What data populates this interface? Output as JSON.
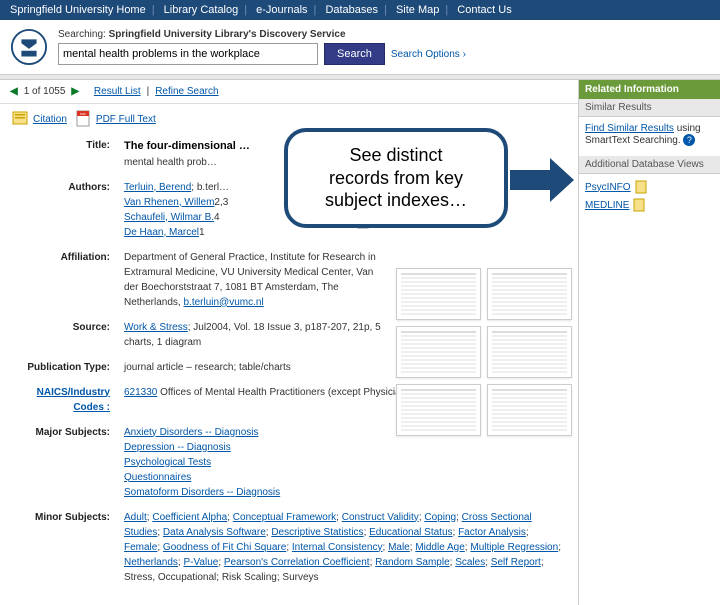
{
  "topnav": {
    "items": [
      "Springfield University Home",
      "Library Catalog",
      "e-Journals",
      "Databases",
      "Site Map",
      "Contact Us"
    ]
  },
  "search": {
    "label_prefix": "Searching:",
    "label_bold": "Springfield University Library's Discovery Service",
    "value": "mental health problems in the workplace",
    "button": "Search",
    "options": "Search Options ›"
  },
  "pager": {
    "position": "1 of 1055",
    "result_list": "Result List",
    "refine": "Refine Search"
  },
  "toolbar": {
    "citation": "Citation",
    "pdf": "PDF Full Text"
  },
  "record": {
    "title_label": "Title:",
    "title": "The four-dimensional …",
    "title_rest": "mental health prob…",
    "authors_label": "Authors:",
    "authors": [
      {
        "link": "Terluin, Berend",
        "rest": "; b.terl…"
      },
      {
        "link": "Van Rhenen, Willem",
        "rest": "2,3"
      },
      {
        "link": "Schaufeli, Wilmar B.",
        "rest": "4"
      },
      {
        "link": "De Haan, Marcel",
        "rest": "1"
      }
    ],
    "affiliation_label": "Affiliation:",
    "affiliation": "Department of General Practice, Institute for Research in Extramural Medicine, VU University Medical Center, Van der Boechorststraat 7, 1081 BT Amsterdam, The Netherlands, ",
    "affiliation_link": "b.terluin@vumc.nl",
    "source_label": "Source:",
    "source_link": "Work & Stress",
    "source_rest": "; Jul2004, Vol. 18 Issue 3, p187-207, 21p, 5 charts, 1 diagram",
    "pubtype_label": "Publication Type:",
    "pubtype": "journal article – research; table/charts",
    "naics_label": "NAICS/Industry Codes :",
    "naics_link": "621330",
    "naics_rest": " Offices of Mental Health Practitioners (except Physicians)",
    "major_label": "Major Subjects:",
    "major": [
      "Anxiety Disorders -- Diagnosis",
      "Depression -- Diagnosis",
      "Psychological Tests",
      "Questionnaires",
      "Somatoform Disorders -- Diagnosis"
    ],
    "minor_label": "Minor Subjects:",
    "minor_links": [
      "Adult",
      "Coefficient Alpha",
      "Conceptual Framework",
      "Construct Validity",
      "Coping",
      "Cross Sectional Studies",
      "Data Analysis Software",
      "Descriptive Statistics",
      "Educational Status",
      "Factor Analysis",
      "Female",
      "Goodness of Fit Chi Square",
      "Internal Consistency",
      "Male",
      "Middle Age",
      "Multiple Regression",
      "Netherlands",
      "P-Value",
      "Pearson's Correlation Coefficient",
      "Random Sample",
      "Scales",
      "Self Report"
    ],
    "minor_plain": "; Stress, Occupational; Risk Scaling; Surveys"
  },
  "sidebar": {
    "related_head": "Related Information",
    "similar_head": "Similar Results",
    "similar_link": "Find Similar Results",
    "similar_rest": " using SmartText Searching.",
    "adv_head": "Additional Database Views",
    "db1": "PsycINFO",
    "db2": "MEDLINE"
  },
  "callout": {
    "line1": "See distinct",
    "line2": "records from key",
    "line3": "subject indexes…"
  }
}
